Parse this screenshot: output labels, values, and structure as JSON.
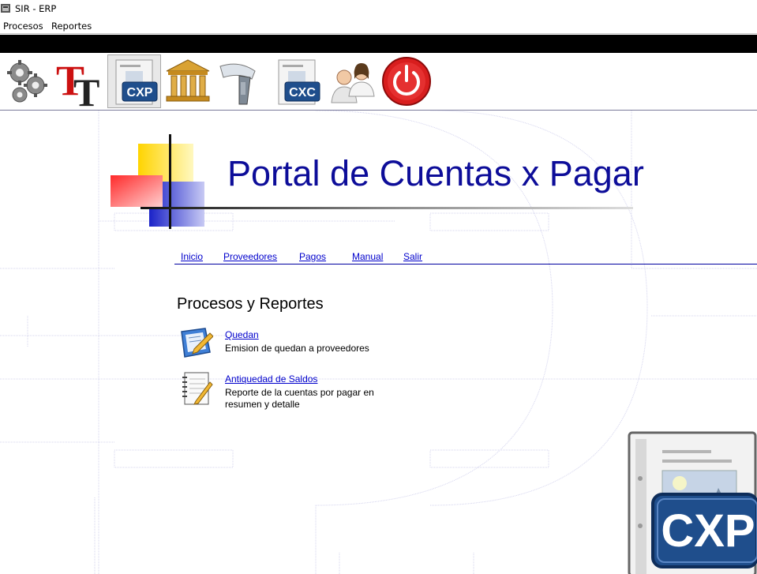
{
  "window": {
    "title": "SIR - ERP"
  },
  "menu": {
    "items": [
      "Procesos",
      "Reportes"
    ]
  },
  "toolbar": {
    "buttons": [
      {
        "name": "gears",
        "label": ""
      },
      {
        "name": "text",
        "label": ""
      },
      {
        "name": "cxp",
        "label": "CXP",
        "active": true
      },
      {
        "name": "bank",
        "label": ""
      },
      {
        "name": "scanner",
        "label": ""
      },
      {
        "name": "cxc",
        "label": "CXC"
      },
      {
        "name": "users",
        "label": ""
      },
      {
        "name": "power",
        "label": ""
      }
    ]
  },
  "portal": {
    "title": "Portal de Cuentas x Pagar"
  },
  "nav": {
    "links": [
      "Inicio",
      "Proveedores",
      "Pagos",
      "Manual",
      "Salir"
    ]
  },
  "section": {
    "title": "Procesos y Reportes",
    "items": [
      {
        "link": "Quedan",
        "description": "Emision de quedan a proveedores"
      },
      {
        "link": "Antiquedad de Saldos",
        "description": "Reporte de la cuentas por pagar en resumen y detalle"
      }
    ]
  },
  "badge": {
    "label": "CXP"
  },
  "colors": {
    "accent": "#0d0d99",
    "link": "#0000cc",
    "badge": "#1f4e8c"
  }
}
